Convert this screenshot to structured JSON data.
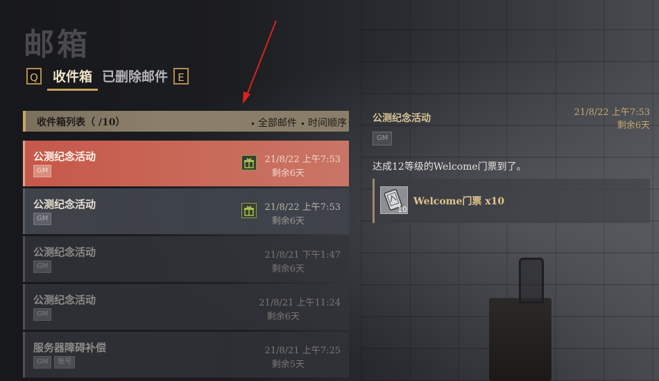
{
  "title": "邮箱",
  "tabs": {
    "prev_key": "Q",
    "next_key": "E",
    "inbox": "收件箱",
    "deleted": "已删除邮件"
  },
  "list_header": {
    "title": "收件箱列表（  /10）",
    "all_mail": "全部邮件",
    "time_order": "时间顺序"
  },
  "mails": [
    {
      "subject": "公测纪念活动",
      "badges": [
        "GM"
      ],
      "date": "21/8/22 上午7:53",
      "remaining": "剩余6天",
      "has_gift": true,
      "state": "selected"
    },
    {
      "subject": "公测纪念活动",
      "badges": [
        "GM"
      ],
      "date": "21/8/22 上午7:53",
      "remaining": "剩余6天",
      "has_gift": true,
      "state": "unread"
    },
    {
      "subject": "公测纪念活动",
      "badges": [
        "GM"
      ],
      "date": "21/8/21 下午1:47",
      "remaining": "剩余6天",
      "has_gift": false,
      "state": "read"
    },
    {
      "subject": "公测纪念活动",
      "badges": [
        "GM"
      ],
      "date": "21/8/21 上午11:24",
      "remaining": "剩余6天",
      "has_gift": false,
      "state": "read"
    },
    {
      "subject": "服务器障碍补偿",
      "badges": [
        "GM",
        "账号"
      ],
      "date": "21/8/21 上午7:25",
      "remaining": "剩余5天",
      "has_gift": false,
      "state": "read"
    }
  ],
  "detail": {
    "subject": "公测纪念活动",
    "badge": "GM",
    "date": "21/8/22 上午7:53",
    "remaining": "剩余6天",
    "body": "达成12等级的Welcome门票到了。",
    "reward": {
      "name": "Welcome门票 x10",
      "quantity": "10",
      "icon": "ticket-icon"
    }
  },
  "colors": {
    "selected_row": "#c6584a",
    "accent_gold": "#c9a35c",
    "annotation_arrow": "#e02020"
  }
}
